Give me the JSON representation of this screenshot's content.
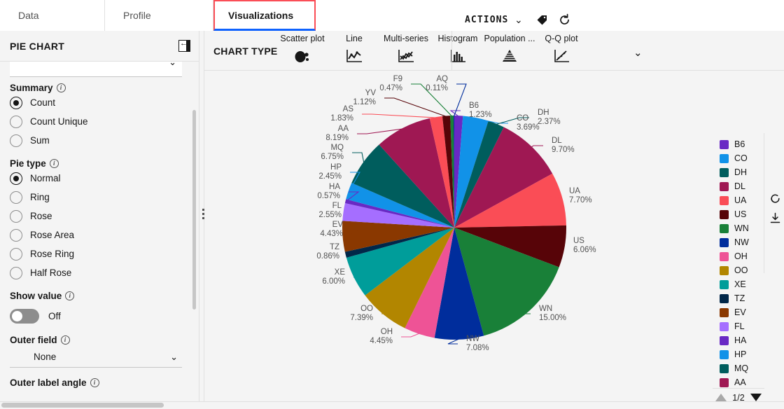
{
  "tabs": [
    {
      "label": "Data",
      "active": false
    },
    {
      "label": "Profile",
      "active": false
    },
    {
      "label": "Visualizations",
      "active": true
    }
  ],
  "left_panel": {
    "title": "PIE CHART",
    "collapse_icon": "collapse-panel-icon",
    "dropdown_top": {
      "value": ""
    },
    "groups": [
      {
        "label": "Summary",
        "info_icon": "info-icon",
        "options": [
          {
            "label": "Count",
            "selected": true
          },
          {
            "label": "Count Unique",
            "selected": false
          },
          {
            "label": "Sum",
            "selected": false
          }
        ]
      },
      {
        "label": "Pie type",
        "info_icon": "info-icon",
        "options": [
          {
            "label": "Normal",
            "selected": true
          },
          {
            "label": "Ring",
            "selected": false
          },
          {
            "label": "Rose",
            "selected": false
          },
          {
            "label": "Rose Area",
            "selected": false
          },
          {
            "label": "Rose Ring",
            "selected": false
          },
          {
            "label": "Half Rose",
            "selected": false
          }
        ]
      }
    ],
    "show_value": {
      "label": "Show value",
      "state": "Off",
      "on": false
    },
    "outer_field": {
      "label": "Outer field",
      "value": "None"
    },
    "outer_label_angle": {
      "label": "Outer label angle"
    }
  },
  "toolbar": {
    "chart_type_label": "CHART TYPE",
    "chart_types": [
      {
        "label": "Scatter plot",
        "icon": "scatter-plot-icon"
      },
      {
        "label": "Line",
        "icon": "line-chart-icon"
      },
      {
        "label": "Multi-series",
        "icon": "multi-series-icon"
      },
      {
        "label": "Histogram",
        "icon": "histogram-icon"
      },
      {
        "label": "Population ...",
        "icon": "population-pyramid-icon"
      },
      {
        "label": "Q-Q plot",
        "icon": "qq-plot-icon"
      }
    ],
    "expand_icon": "chevron-double-down-icon",
    "actions_label": "ACTIONS",
    "actions_chevron": "chevron-down-icon",
    "tag_icon": "tag-icon",
    "refresh_icon": "refresh-icon"
  },
  "side_icons": [
    {
      "name": "rotate-icon"
    },
    {
      "name": "download-icon"
    }
  ],
  "legend": {
    "page": "1/2",
    "prev_icon": "triangle-up-icon",
    "next_icon": "triangle-down-icon",
    "items": [
      {
        "label": "B6",
        "color": "#6929c4"
      },
      {
        "label": "CO",
        "color": "#1192e8"
      },
      {
        "label": "DH",
        "color": "#005d5d"
      },
      {
        "label": "DL",
        "color": "#9f1853"
      },
      {
        "label": "UA",
        "color": "#fa4d56"
      },
      {
        "label": "US",
        "color": "#570408"
      },
      {
        "label": "WN",
        "color": "#198038"
      },
      {
        "label": "NW",
        "color": "#002d9c"
      },
      {
        "label": "OH",
        "color": "#ee5396"
      },
      {
        "label": "OO",
        "color": "#b28600"
      },
      {
        "label": "XE",
        "color": "#009d9a"
      },
      {
        "label": "TZ",
        "color": "#012749"
      },
      {
        "label": "EV",
        "color": "#8a3800"
      },
      {
        "label": "FL",
        "color": "#a56eff"
      },
      {
        "label": "HA",
        "color": "#6929c4"
      },
      {
        "label": "HP",
        "color": "#1192e8"
      },
      {
        "label": "MQ",
        "color": "#005d5d"
      },
      {
        "label": "AA",
        "color": "#9f1853"
      }
    ]
  },
  "chart_data": {
    "type": "pie",
    "title": "",
    "summary": "Count",
    "pie_type": "Normal",
    "labels": [
      "B6",
      "CO",
      "DH",
      "DL",
      "UA",
      "US",
      "WN",
      "NW",
      "OH",
      "OO",
      "XE",
      "TZ",
      "EV",
      "FL",
      "HA",
      "HP",
      "MQ",
      "AA",
      "AS",
      "YV",
      "F9",
      "AQ"
    ],
    "values": [
      1.23,
      3.69,
      2.37,
      9.7,
      7.7,
      6.06,
      15.0,
      7.08,
      4.45,
      7.39,
      6.0,
      0.86,
      4.43,
      2.55,
      0.57,
      2.45,
      6.75,
      8.19,
      1.83,
      1.12,
      0.47,
      0.11
    ],
    "value_labels": [
      "1.23%",
      "3.69%",
      "2.37%",
      "9.70%",
      "7.70%",
      "6.06%",
      "15.00%",
      "7.08%",
      "4.45%",
      "7.39%",
      "6.00%",
      "0.86%",
      "4.43%",
      "2.55%",
      "0.57%",
      "2.45%",
      "6.75%",
      "8.19%",
      "1.83%",
      "1.12%",
      "0.47%",
      "0.11%"
    ],
    "colors": [
      "#6929c4",
      "#1192e8",
      "#005d5d",
      "#9f1853",
      "#fa4d56",
      "#570408",
      "#198038",
      "#002d9c",
      "#ee5396",
      "#b28600",
      "#009d9a",
      "#012749",
      "#8a3800",
      "#a56eff",
      "#6929c4",
      "#1192e8",
      "#005d5d",
      "#9f1853",
      "#fa4d56",
      "#570408",
      "#198038",
      "#002d9c"
    ],
    "units": "percent",
    "legend_position": "right",
    "start_angle_deg": 90,
    "direction": "clockwise"
  }
}
